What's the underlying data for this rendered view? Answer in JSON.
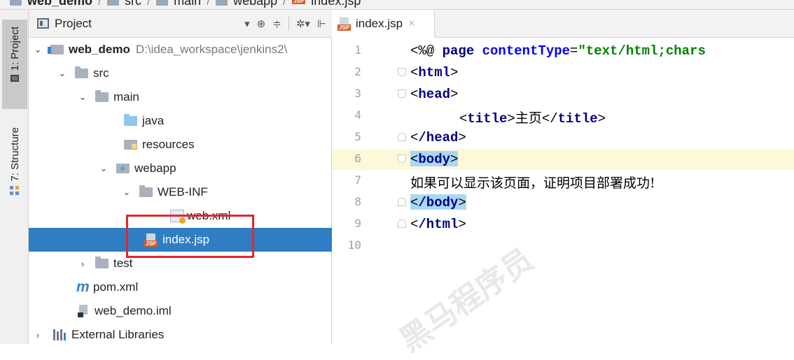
{
  "breadcrumb": {
    "items": [
      "web_demo",
      "src",
      "main",
      "webapp",
      "index.jsp"
    ]
  },
  "tool_stripe": {
    "project_tab": "1: Project",
    "structure_tab": "7: Structure"
  },
  "project_panel": {
    "title": "Project",
    "tree": [
      {
        "label": "web_demo",
        "detail": "D:\\idea_workspace\\jenkins2\\"
      },
      {
        "label": "src"
      },
      {
        "label": "main"
      },
      {
        "label": "java"
      },
      {
        "label": "resources"
      },
      {
        "label": "webapp"
      },
      {
        "label": "WEB-INF"
      },
      {
        "label": "web.xml"
      },
      {
        "label": "index.jsp"
      },
      {
        "label": "test"
      },
      {
        "label": "pom.xml"
      },
      {
        "label": "web_demo.iml"
      },
      {
        "label": "External Libraries"
      }
    ]
  },
  "editor": {
    "tab_label": "index.jsp",
    "close_glyph": "×",
    "line_numbers": [
      "1",
      "2",
      "3",
      "4",
      "5",
      "6",
      "7",
      "8",
      "9",
      "10"
    ],
    "lines": {
      "l1_open": "<%@ ",
      "l1_kw": "page",
      "l1_attr": " contentType",
      "l1_eq": "=",
      "l1_str": "\"text/html;chars",
      "l2": "html",
      "l3": "head",
      "l4_tag": "title",
      "l4_text": "主页",
      "l5": "/head",
      "l6": "body",
      "l7": "如果可以显示该页面，证明项目部署成功!",
      "l8": "/body",
      "l9": "/html"
    }
  },
  "watermark": {
    "text": "黑马程序员"
  },
  "colors": {
    "selection": "#2f7ec4",
    "annotation_box": "#e4252e",
    "current_line": "#fcf8d8",
    "tag_highlight": "#a9d7f5"
  }
}
